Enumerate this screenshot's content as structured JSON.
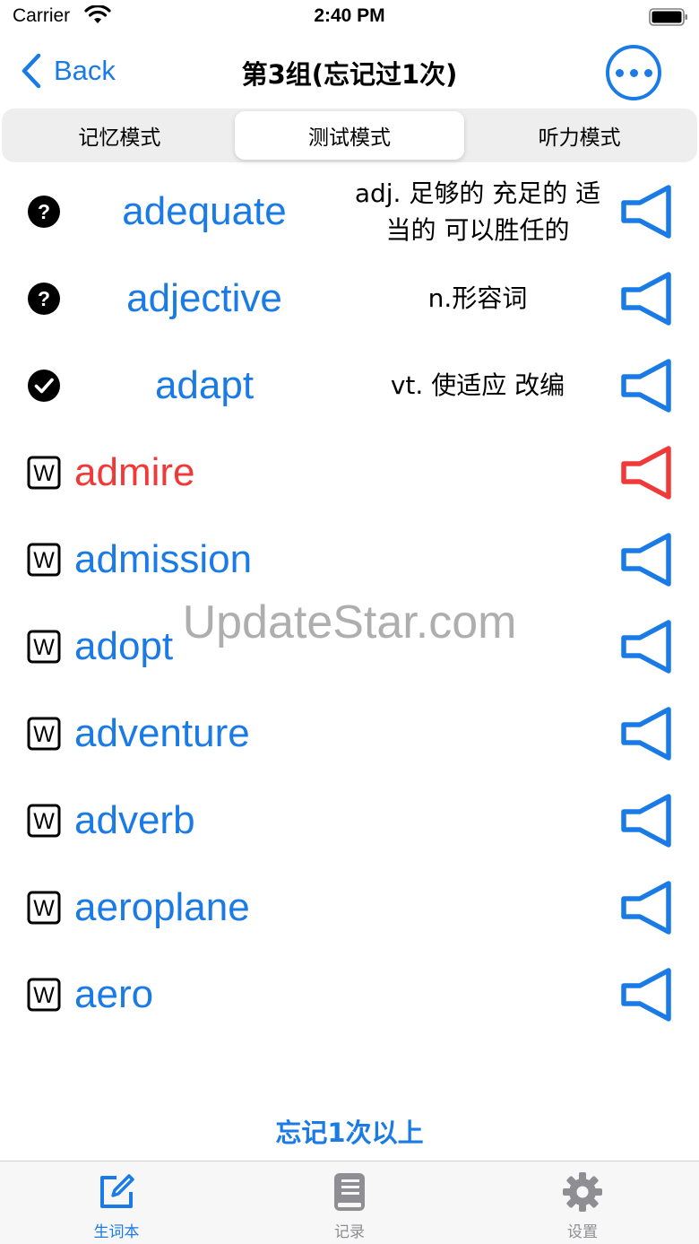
{
  "status_bar": {
    "carrier": "Carrier",
    "time": "2:40 PM"
  },
  "nav": {
    "back_label": "Back",
    "title": "第3组(忘记过1次)"
  },
  "segments": [
    {
      "label": "记忆模式",
      "active": false
    },
    {
      "label": "测试模式",
      "active": true
    },
    {
      "label": "听力模式",
      "active": false
    }
  ],
  "words": [
    {
      "word": "adequate",
      "meaning": "adj. 足够的 充足的 适当的 可以胜任的",
      "status": "unknown-icon",
      "color": "#1a7be6"
    },
    {
      "word": "adjective",
      "meaning": "n.形容词",
      "status": "unknown-icon",
      "color": "#1a7be6"
    },
    {
      "word": "adapt",
      "meaning": "vt. 使适应 改编",
      "status": "checkmark-icon",
      "color": "#1a7be6"
    },
    {
      "word": "admire",
      "meaning": "",
      "status": "w-icon",
      "color": "#f03a3a"
    },
    {
      "word": "admission",
      "meaning": "",
      "status": "w-icon",
      "color": "#1a7be6"
    },
    {
      "word": "adopt",
      "meaning": "",
      "status": "w-icon",
      "color": "#1a7be6"
    },
    {
      "word": "adventure",
      "meaning": "",
      "status": "w-icon",
      "color": "#1a7be6"
    },
    {
      "word": "adverb",
      "meaning": "",
      "status": "w-icon",
      "color": "#1a7be6"
    },
    {
      "word": "aeroplane",
      "meaning": "",
      "status": "w-icon",
      "color": "#1a7be6"
    },
    {
      "word": "aero",
      "meaning": "",
      "status": "w-icon",
      "color": "#1a7be6"
    }
  ],
  "watermark": "UpdateStar.com",
  "footer_link": "忘记1次以上",
  "tabs": [
    {
      "label": "生词本",
      "icon": "edit-icon",
      "active": true
    },
    {
      "label": "记录",
      "icon": "book-icon",
      "active": false
    },
    {
      "label": "设置",
      "icon": "gear-icon",
      "active": false
    }
  ],
  "colors": {
    "accent": "#1a7be6",
    "alert": "#f03a3a",
    "inactive": "#8e8e93"
  }
}
